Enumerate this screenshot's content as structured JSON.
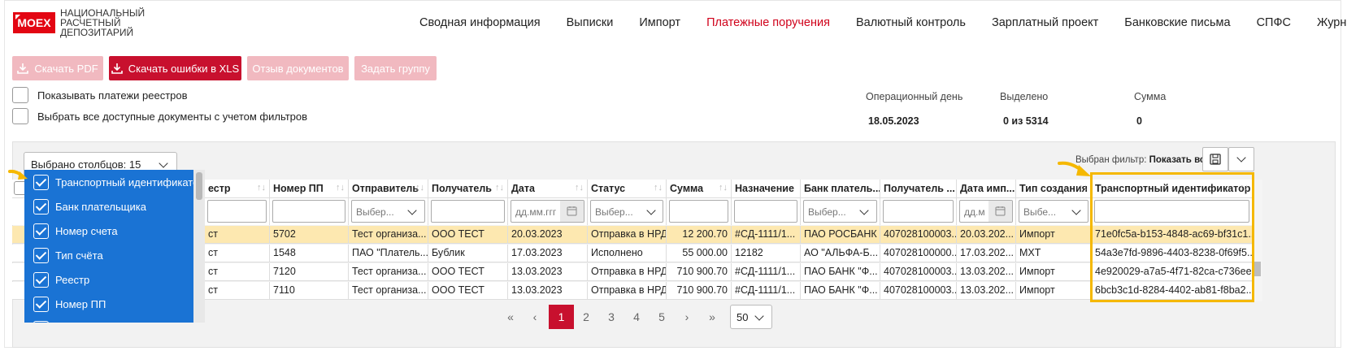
{
  "header": {
    "logo_mark": "MOEX",
    "logo_lines": [
      "НАЦИОНАЛЬНЫЙ",
      "РАСЧЕТНЫЙ",
      "ДЕПОЗИТАРИЙ"
    ],
    "nav": [
      {
        "label": "Сводная информация",
        "active": false
      },
      {
        "label": "Выписки",
        "active": false
      },
      {
        "label": "Импорт",
        "active": false
      },
      {
        "label": "Платежные поручения",
        "active": true
      },
      {
        "label": "Валютный контроль",
        "active": false
      },
      {
        "label": "Зарплатный проект",
        "active": false
      },
      {
        "label": "Банковские письма",
        "active": false
      },
      {
        "label": "СПФС",
        "active": false
      },
      {
        "label": "Журнал",
        "active": false
      }
    ]
  },
  "toolbar": {
    "download_pdf": "Скачать PDF",
    "download_errors": "Скачать ошибки в XLS",
    "recall_docs": "Отзыв документов",
    "set_group": "Задать группу"
  },
  "options": {
    "show_registry_payments": "Показывать платежи реестров",
    "select_all_filtered": "Выбрать все доступные документы с учетом фильтров"
  },
  "summary": {
    "op_day_label": "Операционный день",
    "op_day_value": "18.05.2023",
    "selected_label": "Выделено",
    "selected_value": "0 из 5314",
    "sum_label": "Сумма",
    "sum_value": "0"
  },
  "grid": {
    "columns_selected": "Выбрано столбцов: 15",
    "filter_prefix": "Выбран фильтр:",
    "filter_name": "Показать всё",
    "headers": [
      "естр",
      "Номер ПП",
      "Отправитель",
      "Получатель",
      "Дата",
      "Статус",
      "Сумма",
      "Назначение",
      "Банк платель...",
      "Получатель ...",
      "Дата имп...",
      "Тип создания",
      "Транспортный идентификатор"
    ],
    "filter_placeholders": {
      "select": "Выбер...",
      "select_short": "Выбе...",
      "date": "дд.мм.ггг",
      "date_short": "дд.м"
    },
    "rows": [
      [
        "ст",
        "5702",
        "Тест организа...",
        "ООО ТЕСТ",
        "20.03.2023",
        "Отправка в НРД",
        "12 200.70",
        "#СД-1111/1...",
        "ПАО РОСБАНК",
        "407028100003...",
        "20.03.202...",
        "Импорт",
        "71e0fc5a-b153-4848-ac69-bf31c1..."
      ],
      [
        "ст",
        "1548",
        "ПАО \"Платель...",
        "Бублик",
        "17.03.2023",
        "Исполнено",
        "55 000.00",
        "12182",
        "АО \"АЛЬФА-Б...",
        "407028100000...",
        "17.03.202...",
        "MXT",
        "54a3e7fd-9896-4403-8238-0f69f5..."
      ],
      [
        "ст",
        "7120",
        "Тест организа...",
        "ООО ТЕСТ",
        "13.03.2023",
        "Отправка в НРД",
        "710 900.70",
        "#СД-1111/1...",
        "ПАО БАНК \"Ф...",
        "407028100003...",
        "13.03.202...",
        "Импорт",
        "4e920029-a7a5-4f71-82ca-c736ee..."
      ],
      [
        "ст",
        "7110",
        "Тест организа...",
        "ООО ТЕСТ",
        "13.03.2023",
        "Отправка в НРД",
        "710 900.70",
        "#СД-1111/1...",
        "ПАО БАНК \"Ф...",
        "407028100003...",
        "13.03.202...",
        "Импорт",
        "6bcb3c1d-8284-4402-ab81-f8ba2..."
      ]
    ]
  },
  "column_popup": {
    "items": [
      "Транспортный идентификатор",
      "Банк плательщика",
      "Номер счета",
      "Тип счёта",
      "Реестр",
      "Номер ПП"
    ]
  },
  "pagination": {
    "first": "«",
    "prev": "‹",
    "pages": [
      "1",
      "2",
      "3",
      "4",
      "5"
    ],
    "current": "1",
    "next": "›",
    "last": "»",
    "page_size": "50"
  },
  "colors": {
    "brand_red": "#c8102e",
    "popup_blue": "#1a73d4",
    "highlight_yellow": "#f5b800",
    "row_highlight": "#fde8b0"
  }
}
